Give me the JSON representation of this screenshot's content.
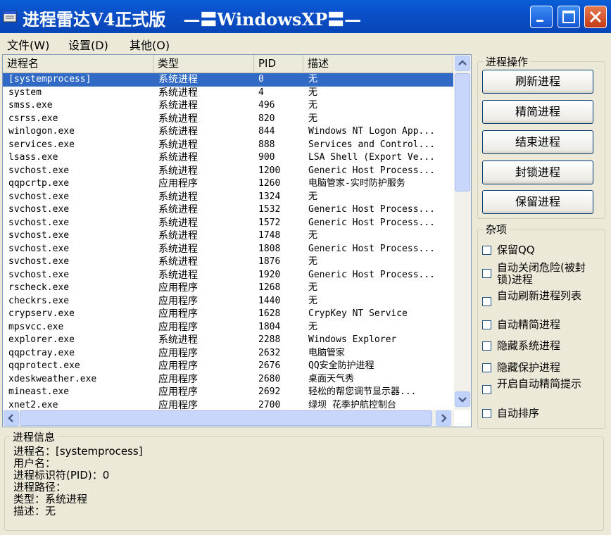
{
  "window": {
    "title": "进程雷达V4正式版   —〓WindowsXP〓—",
    "minimize_icon": "minimize-icon",
    "maximize_icon": "maximize-icon",
    "close_icon": "close-icon"
  },
  "menu": [
    {
      "label": "文件(W)"
    },
    {
      "label": "设置(D)"
    },
    {
      "label": "其他(O)"
    }
  ],
  "process_list": {
    "columns": [
      "进程名",
      "类型",
      "PID",
      "描述"
    ],
    "rows": [
      {
        "name": "[systemprocess]",
        "type": "系统进程",
        "pid": "0",
        "desc": "无",
        "selected": true
      },
      {
        "name": "system",
        "type": "系统进程",
        "pid": "4",
        "desc": "无"
      },
      {
        "name": "smss.exe",
        "type": "系统进程",
        "pid": "496",
        "desc": "无"
      },
      {
        "name": "csrss.exe",
        "type": "系统进程",
        "pid": "820",
        "desc": "无"
      },
      {
        "name": "winlogon.exe",
        "type": "系统进程",
        "pid": "844",
        "desc": "Windows NT Logon App..."
      },
      {
        "name": "services.exe",
        "type": "系统进程",
        "pid": "888",
        "desc": "Services and Control..."
      },
      {
        "name": "lsass.exe",
        "type": "系统进程",
        "pid": "900",
        "desc": "LSA Shell (Export Ve..."
      },
      {
        "name": "svchost.exe",
        "type": "系统进程",
        "pid": "1200",
        "desc": "Generic Host Process..."
      },
      {
        "name": "qqpcrtp.exe",
        "type": "应用程序",
        "pid": "1260",
        "desc": "电脑管家-实时防护服务"
      },
      {
        "name": "svchost.exe",
        "type": "系统进程",
        "pid": "1324",
        "desc": "无"
      },
      {
        "name": "svchost.exe",
        "type": "系统进程",
        "pid": "1532",
        "desc": "Generic Host Process..."
      },
      {
        "name": "svchost.exe",
        "type": "系统进程",
        "pid": "1572",
        "desc": "Generic Host Process..."
      },
      {
        "name": "svchost.exe",
        "type": "系统进程",
        "pid": "1748",
        "desc": "无"
      },
      {
        "name": "svchost.exe",
        "type": "系统进程",
        "pid": "1808",
        "desc": "Generic Host Process..."
      },
      {
        "name": "svchost.exe",
        "type": "系统进程",
        "pid": "1876",
        "desc": "无"
      },
      {
        "name": "svchost.exe",
        "type": "系统进程",
        "pid": "1920",
        "desc": "Generic Host Process..."
      },
      {
        "name": "rscheck.exe",
        "type": "应用程序",
        "pid": "1268",
        "desc": "无"
      },
      {
        "name": "checkrs.exe",
        "type": "应用程序",
        "pid": "1440",
        "desc": "无"
      },
      {
        "name": "crypserv.exe",
        "type": "应用程序",
        "pid": "1628",
        "desc": "CrypKey NT Service"
      },
      {
        "name": "mpsvcc.exe",
        "type": "应用程序",
        "pid": "1804",
        "desc": "无"
      },
      {
        "name": "explorer.exe",
        "type": "系统进程",
        "pid": "2288",
        "desc": "Windows Explorer"
      },
      {
        "name": "qqpctray.exe",
        "type": "应用程序",
        "pid": "2632",
        "desc": "电脑管家"
      },
      {
        "name": "qqprotect.exe",
        "type": "应用程序",
        "pid": "2676",
        "desc": "QQ安全防护进程"
      },
      {
        "name": "xdeskweather.exe",
        "type": "应用程序",
        "pid": "2680",
        "desc": "桌面天气秀"
      },
      {
        "name": "mineast.exe",
        "type": "应用程序",
        "pid": "2692",
        "desc": "轻松的帮您调节显示器..."
      },
      {
        "name": "xnet2.exe",
        "type": "应用程序",
        "pid": "2700",
        "desc": "绿坝 花季护航控制台"
      }
    ]
  },
  "process_ops": {
    "legend": "进程操作",
    "buttons": [
      "刷新进程",
      "精简进程",
      "结束进程",
      "封锁进程",
      "保留进程"
    ]
  },
  "misc": {
    "legend": "杂项",
    "options": [
      {
        "label": "保留QQ",
        "checked": false
      },
      {
        "label": "自动关闭危险(被封锁)进程",
        "checked": false
      },
      {
        "label": "自动刷新进程列表",
        "checked": false
      },
      {
        "label": "自动精简进程",
        "checked": false
      },
      {
        "label": "隐藏系统进程",
        "checked": false
      },
      {
        "label": "隐藏保护进程",
        "checked": false
      },
      {
        "label": "开启自动精简提示",
        "checked": false
      },
      {
        "label": "自动排序",
        "checked": false
      }
    ]
  },
  "process_info": {
    "legend": "进程信息",
    "lines": [
      "进程名：[systemprocess]",
      "用户名：",
      "进程标识符(PID)：0",
      "进程路径：",
      "类型：系统进程",
      "描述：无"
    ]
  },
  "colors": {
    "titlebar": "#0a52cc",
    "selection": "#316ac5",
    "face": "#ece9d8"
  }
}
